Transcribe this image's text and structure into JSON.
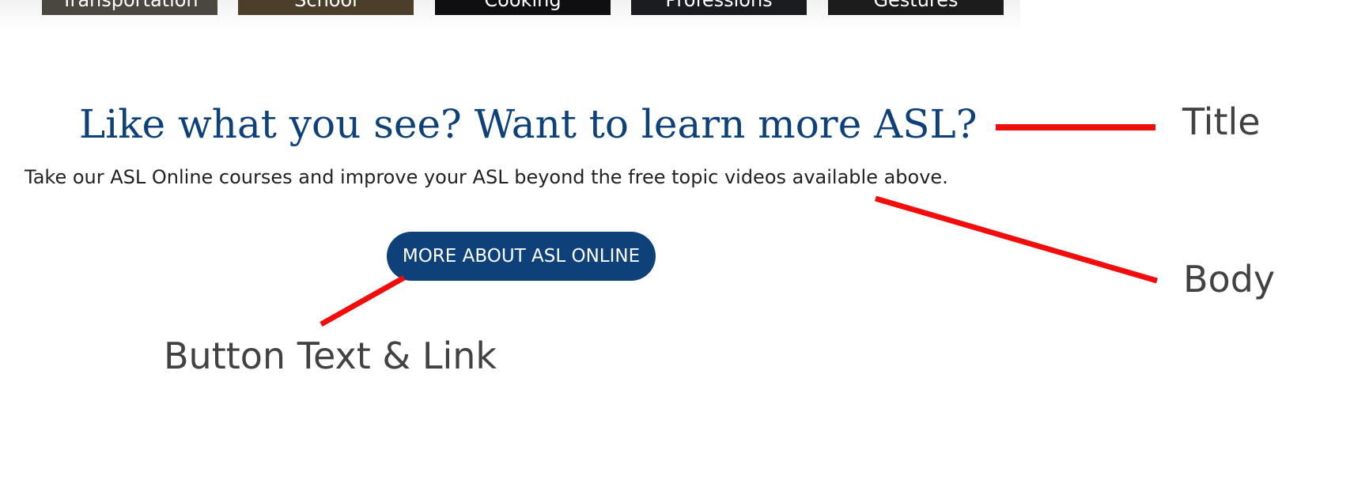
{
  "topics": [
    {
      "label": "Transportation",
      "color": "#4a4740"
    },
    {
      "label": "School",
      "color": "#4b3f2c"
    },
    {
      "label": "Cooking",
      "color": "#0f0f12"
    },
    {
      "label": "Professions",
      "color": "#1a1c20"
    },
    {
      "label": "Gestures",
      "color": "#1c1c1c"
    }
  ],
  "promo": {
    "title": "Like what you see? Want to learn more ASL?",
    "body": "Take our ASL Online courses and improve your ASL beyond the free topic videos available above.",
    "button_label": "MORE ABOUT ASL ONLINE"
  },
  "annotations": {
    "title_label": "Title",
    "body_label": "Body",
    "button_label": "Button Text & Link",
    "line_color": "#f20d0d"
  },
  "colors": {
    "brand_blue": "#0e4179"
  }
}
